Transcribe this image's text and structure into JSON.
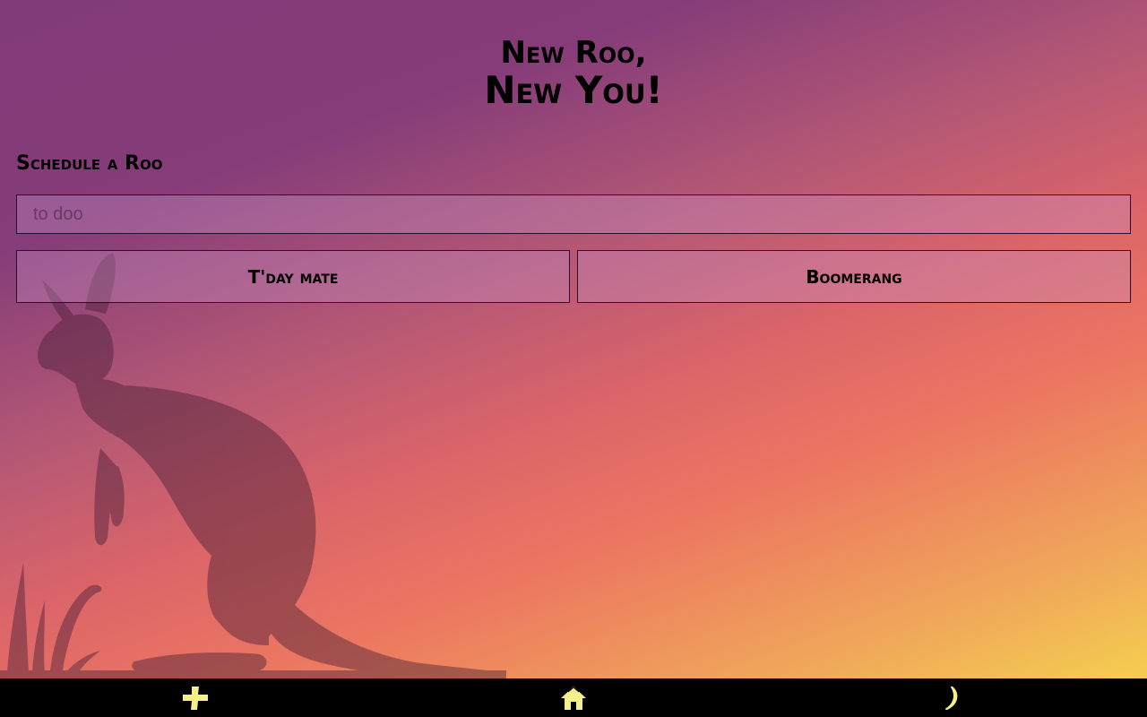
{
  "header": {
    "title_line1": "New Roo,",
    "title_line2": "New You!"
  },
  "form": {
    "section_label": "Schedule a Roo",
    "input_placeholder": "to doo",
    "input_value": "",
    "today_button_label": "T'day mate",
    "boomerang_button_label": "Boomerang"
  },
  "nav": {
    "items": [
      {
        "icon": "plus-icon"
      },
      {
        "icon": "home-icon"
      },
      {
        "icon": "moon-icon"
      }
    ],
    "icon_color": "#f5f08a"
  },
  "colors": {
    "gradient_top": "#823b79",
    "gradient_mid": "#dc6569",
    "gradient_bottom": "#f6d94c",
    "silhouette": "#5a2a3a",
    "bar": "#000000"
  }
}
